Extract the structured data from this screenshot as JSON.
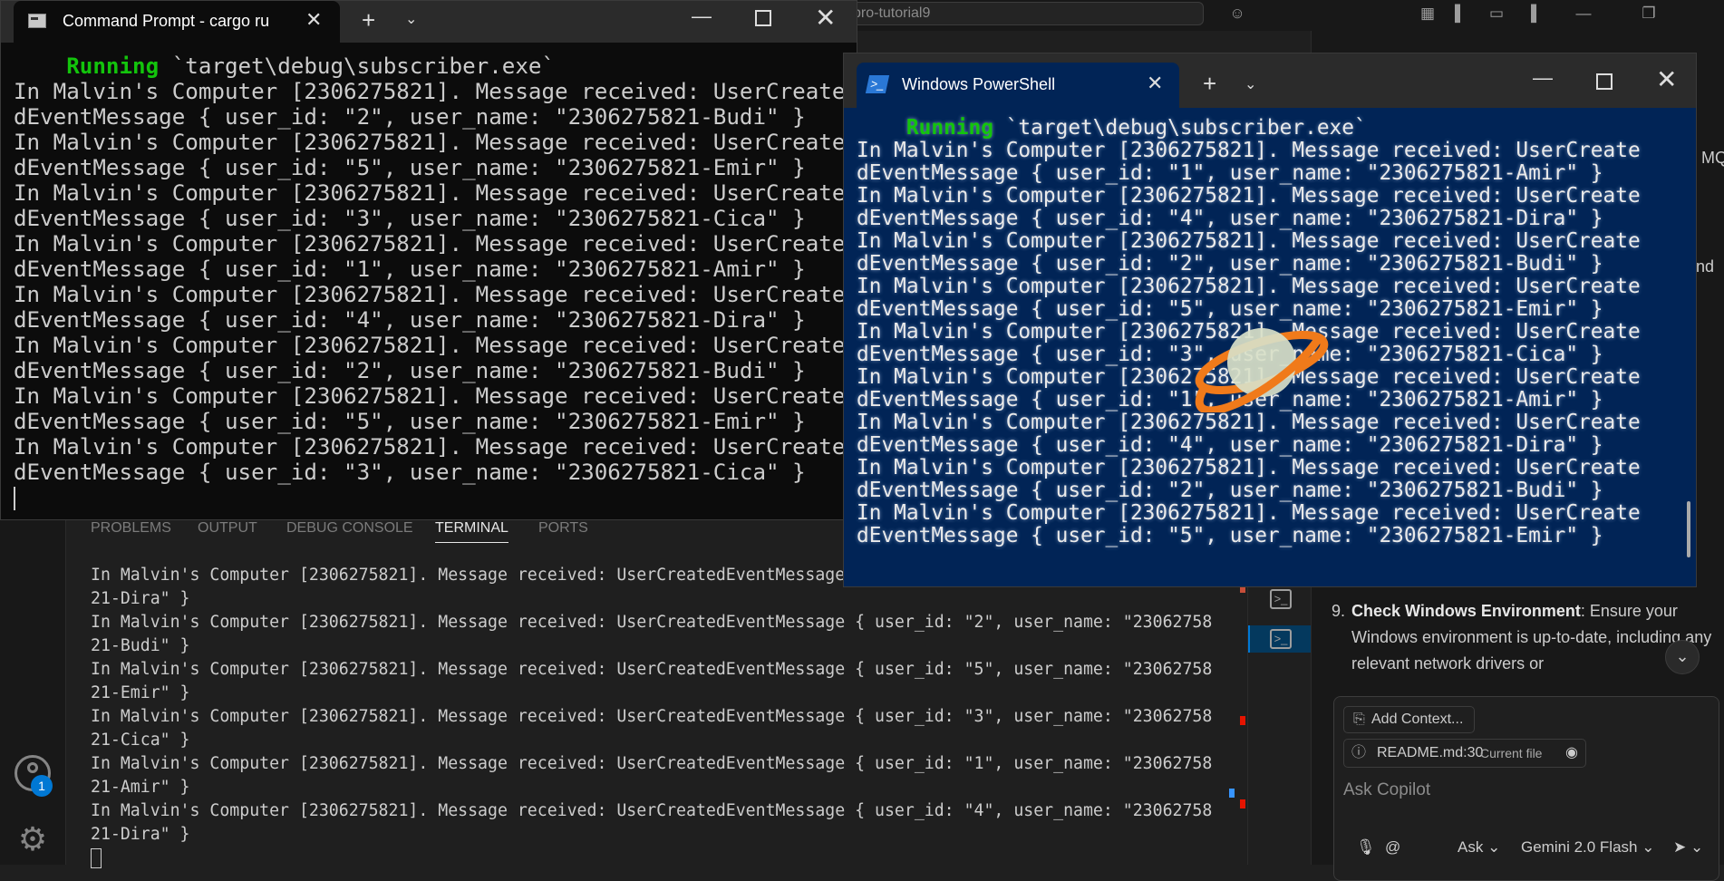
{
  "vscode": {
    "search_text": "pro-tutorial9",
    "panel_tabs": [
      "PROBLEMS",
      "OUTPUT",
      "DEBUG CONSOLE",
      "TERMINAL",
      "PORTS"
    ],
    "terminal_lines": [
      "In Malvin's Computer [2306275821]. Message received: UserCreatedEventMessage { user_id: \"4\", user_name: \"23062758",
      "21-Dira\" }",
      "In Malvin's Computer [2306275821]. Message received: UserCreatedEventMessage { user_id: \"2\", user_name: \"23062758",
      "21-Budi\" }",
      "In Malvin's Computer [2306275821]. Message received: UserCreatedEventMessage { user_id: \"5\", user_name: \"23062758",
      "21-Emir\" }",
      "In Malvin's Computer [2306275821]. Message received: UserCreatedEventMessage { user_id: \"3\", user_name: \"23062758",
      "21-Cica\" }",
      "In Malvin's Computer [2306275821]. Message received: UserCreatedEventMessage { user_id: \"1\", user_name: \"23062758",
      "21-Amir\" }",
      "In Malvin's Computer [2306275821]. Message received: UserCreatedEventMessage { user_id: \"4\", user_name: \"23062758",
      "21-Dira\" }"
    ],
    "account_badge": "1"
  },
  "copilot": {
    "fragment_1": "MQ",
    "fragment_2": "nd",
    "step_number": "9.",
    "step_title": "Check Windows Environment",
    "step_text": ": Ensure your Windows environment is up-to-date, including any relevant network drivers or",
    "add_context": "Add Context...",
    "file_name": "README.md:30",
    "file_sub": "Current file",
    "placeholder": "Ask Copilot",
    "mode": "Ask",
    "model": "Gemini 2.0 Flash"
  },
  "cmd": {
    "title": "Command Prompt - cargo  ru",
    "running_label": "Running",
    "running_path": "`target\\debug\\subscriber.exe`",
    "lines": [
      "In Malvin's Computer [2306275821]. Message received: UserCreate",
      "dEventMessage { user_id: \"2\", user_name: \"2306275821-Budi\" }",
      "In Malvin's Computer [2306275821]. Message received: UserCreate",
      "dEventMessage { user_id: \"5\", user_name: \"2306275821-Emir\" }",
      "In Malvin's Computer [2306275821]. Message received: UserCreate",
      "dEventMessage { user_id: \"3\", user_name: \"2306275821-Cica\" }",
      "In Malvin's Computer [2306275821]. Message received: UserCreate",
      "dEventMessage { user_id: \"1\", user_name: \"2306275821-Amir\" }",
      "In Malvin's Computer [2306275821]. Message received: UserCreate",
      "dEventMessage { user_id: \"4\", user_name: \"2306275821-Dira\" }",
      "In Malvin's Computer [2306275821]. Message received: UserCreate",
      "dEventMessage { user_id: \"2\", user_name: \"2306275821-Budi\" }",
      "In Malvin's Computer [2306275821]. Message received: UserCreate",
      "dEventMessage { user_id: \"5\", user_name: \"2306275821-Emir\" }",
      "In Malvin's Computer [2306275821]. Message received: UserCreate",
      "dEventMessage { user_id: \"3\", user_name: \"2306275821-Cica\" }"
    ]
  },
  "powershell": {
    "title": "Windows PowerShell",
    "running_label": "Running",
    "running_path": "`target\\debug\\subscriber.exe`",
    "lines": [
      "In Malvin's Computer [2306275821]. Message received: UserCreate",
      "dEventMessage { user_id: \"1\", user_name: \"2306275821-Amir\" }",
      "In Malvin's Computer [2306275821]. Message received: UserCreate",
      "dEventMessage { user_id: \"4\", user_name: \"2306275821-Dira\" }",
      "In Malvin's Computer [2306275821]. Message received: UserCreate",
      "dEventMessage { user_id: \"2\", user_name: \"2306275821-Budi\" }",
      "In Malvin's Computer [2306275821]. Message received: UserCreate",
      "dEventMessage { user_id: \"5\", user_name: \"2306275821-Emir\" }",
      "In Malvin's Computer [2306275821]. Message received: UserCreate",
      "dEventMessage { user_id: \"3\", user_name: \"2306275821-Cica\" }",
      "In Malvin's Computer [2306275821]. Message received: UserCreate",
      "dEventMessage { user_id: \"1\", user_name: \"2306275821-Amir\" }",
      "In Malvin's Computer [2306275821]. Message received: UserCreate",
      "dEventMessage { user_id: \"4\", user_name: \"2306275821-Dira\" }",
      "In Malvin's Computer [2306275821]. Message received: UserCreate",
      "dEventMessage { user_id: \"2\", user_name: \"2306275821-Budi\" }",
      "In Malvin's Computer [2306275821]. Message received: UserCreate",
      "dEventMessage { user_id: \"5\", user_name: \"2306275821-Emir\" }"
    ]
  }
}
